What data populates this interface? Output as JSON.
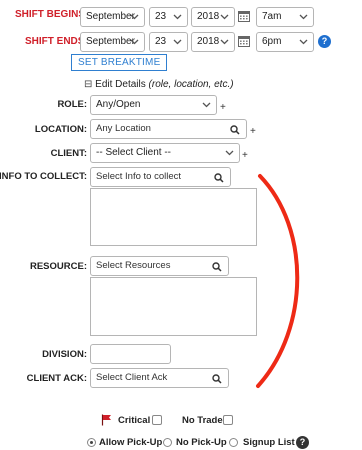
{
  "shift_begins": {
    "label": "SHIFT BEGINS:",
    "month": "September",
    "day": "23",
    "year": "2018",
    "time": "7am"
  },
  "shift_ends": {
    "label": "SHIFT ENDS:",
    "month": "September",
    "day": "23",
    "year": "2018",
    "time": "6pm"
  },
  "set_breaktime_label": "SET BREAKTIME",
  "edit_details": {
    "toggle": "⊟",
    "label": "Edit Details",
    "hint": "(role, location, etc.)"
  },
  "role": {
    "label": "ROLE:",
    "value": "Any/Open"
  },
  "location": {
    "label": "LOCATION:",
    "placeholder": "Any Location"
  },
  "client": {
    "label": "CLIENT:",
    "value": "-- Select Client --"
  },
  "info_to_collect": {
    "label": "INFO TO COLLECT:",
    "placeholder": "Select Info to collect"
  },
  "resource": {
    "label": "RESOURCE:",
    "placeholder": "Select Resources"
  },
  "division": {
    "label": "DIVISION:",
    "value": ""
  },
  "client_ack": {
    "label": "CLIENT ACK:",
    "placeholder": "Select Client Ack"
  },
  "plus": "+",
  "critical_label": "Critical",
  "no_trade_label": "No Trade",
  "pickup": {
    "options": [
      "Allow Pick-Up",
      "No Pick-Up",
      "Signup List"
    ],
    "selected": "Allow Pick-Up"
  },
  "help_glyph": "?",
  "colors": {
    "required_label": "#d0202a",
    "link_blue": "#2f7fd0",
    "annotation_arc": "#ee2a16",
    "flag": "#d0202a"
  },
  "icons": {
    "calendar": "calendar-icon",
    "search": "search-icon",
    "chevron": "chevron-down-icon",
    "help": "question-circle-icon",
    "flag": "flag-icon"
  }
}
